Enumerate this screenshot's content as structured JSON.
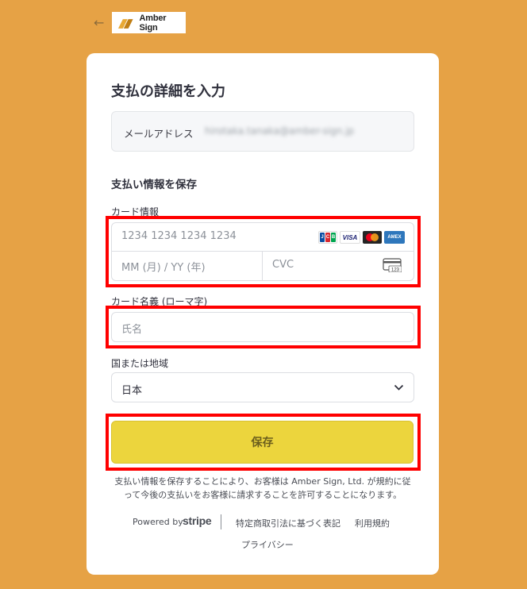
{
  "header": {
    "back_icon": "arrow-left-icon",
    "logo_text": "Amber Sign",
    "logo_colors": {
      "mark": "#e8a935",
      "mark_dark": "#c07e14"
    }
  },
  "form": {
    "title": "支払の詳細を入力",
    "email": {
      "label": "メールアドレス",
      "value": "hirotaka.tanaka@amber-sign.jp"
    },
    "save_info_heading": "支払い情報を保存",
    "card": {
      "label": "カード情報",
      "number_placeholder": "1234 1234 1234 1234",
      "expiry_placeholder": "MM (月) / YY (年)",
      "cvc_placeholder": "CVC",
      "brands": [
        "JCB",
        "VISA",
        "Mastercard",
        "AMEX"
      ],
      "cvc_icon_text": "123"
    },
    "cardholder": {
      "label": "カード名義 (ローマ字)",
      "placeholder": "氏名"
    },
    "country": {
      "label": "国または地域",
      "value": "日本"
    },
    "save_button": "保存",
    "legal_text": "支払い情報を保存することにより、お客様は Amber Sign, Ltd. が規約に従って今後の支払いをお客様に請求することを許可することになります。"
  },
  "footer": {
    "powered_by": "Powered by",
    "stripe": "stripe",
    "links": [
      "特定商取引法に基づく表記",
      "利用規約",
      "プライバシー"
    ]
  },
  "colors": {
    "background": "#e6a245",
    "save_button": "#ecd53d",
    "highlight": "#ff0000"
  }
}
